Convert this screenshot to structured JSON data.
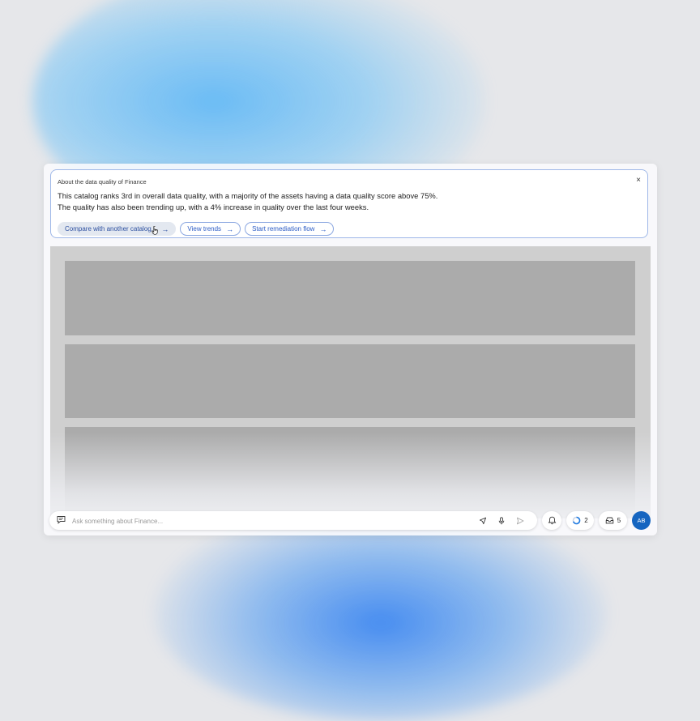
{
  "insight": {
    "title": "About the data quality of Finance",
    "close": "×",
    "line1": "This catalog ranks 3rd in overall data quality, with a majority of the assets having a data quality score above 75%.",
    "line2": "The quality has also been trending up, with a 4% increase in quality over the last four weeks.",
    "actions": [
      {
        "label": "Compare with another catalog...",
        "arrow": "→",
        "state": "hover"
      },
      {
        "label": "View trends",
        "arrow": "→"
      },
      {
        "label": "Start remediation flow",
        "arrow": "→"
      }
    ]
  },
  "chat": {
    "placeholder": "Ask something about Finance...",
    "icons": [
      "chat-icon",
      "pointer-icon",
      "microphone-icon",
      "send-icon"
    ]
  },
  "toolbar": {
    "notifications_icon": "bell-icon",
    "tasks_count": "2",
    "tasks_icon": "progress-ring-icon",
    "inbox_count": "5",
    "inbox_icon": "inbox-icon",
    "avatar_initials": "AB"
  },
  "colors": {
    "accent": "#2c5cc5",
    "pill_border": "#8aa6e0",
    "avatar": "#1565c0",
    "placeholder_block": "#ababab",
    "progress_ring": "#1f7ae0"
  }
}
